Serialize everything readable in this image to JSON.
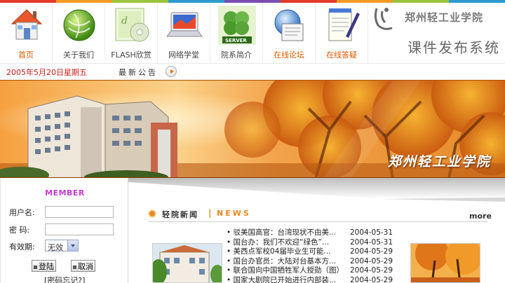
{
  "nav": {
    "items": [
      {
        "label": "首页",
        "icon": "home-icon",
        "style": "red"
      },
      {
        "label": "关于我们",
        "icon": "globe-icon",
        "style": "dark"
      },
      {
        "label": "FLASH欣赏",
        "icon": "flash-cd-icon",
        "style": "dark"
      },
      {
        "label": "网络学堂",
        "icon": "laptop-icon",
        "style": "dark"
      },
      {
        "label": "院系简介",
        "icon": "server-clover-icon",
        "style": "dark"
      },
      {
        "label": "在线论坛",
        "icon": "globe-document-icon",
        "style": "red"
      },
      {
        "label": "在线答疑",
        "icon": "notepad-pen-icon",
        "style": "red"
      }
    ],
    "strip_colors": [
      "#e23a2a",
      "#f29a23",
      "#9bc53d",
      "#2d9ad0",
      "#7b4fb0",
      "#e23a2a",
      "#f29a23",
      "#9bc53d",
      "#2d9ad0"
    ]
  },
  "brand": {
    "school_name": "郑州轻工业学院",
    "system_title": "课件发布系统"
  },
  "datebar": {
    "date": "2005年5月20日星期五",
    "notice_label": "最新公告"
  },
  "banner": {
    "caption": "郑州轻工业学院"
  },
  "login": {
    "title": "MEMBER",
    "username_label": "用户名:",
    "password_label": "密  码:",
    "expire_label": "有效期:",
    "expire_value": "无效",
    "login_button": "登陆",
    "cancel_button": "取消",
    "forgot_link": "[密码忘记?]"
  },
  "news": {
    "title_cn": "轻院新闻",
    "divider": "|",
    "title_en": "NEWS",
    "more": "more",
    "items": [
      {
        "title": "• 驳美国高官：台湾现状不由美...",
        "date": "2004-05-31"
      },
      {
        "title": "• 国台办：我们不欢迎“绿色”...",
        "date": "2004-05-31"
      },
      {
        "title": "• 美西点军校04届毕业生可能...",
        "date": "2004-05-29"
      },
      {
        "title": "• 国台办官员：大陆对台基本方...",
        "date": "2004-05-29"
      },
      {
        "title": "• 联合国向中国牺牲军人授勋（图）",
        "date": "2004-05-29"
      },
      {
        "title": "• 国家大剧院已开始进行内部装...",
        "date": "2004-05-29"
      }
    ]
  },
  "colors": {
    "accent_orange": "#e88a20",
    "date_red": "#c23a1a",
    "member_purple": "#c23ed3",
    "nav_red": "#e05a00"
  }
}
